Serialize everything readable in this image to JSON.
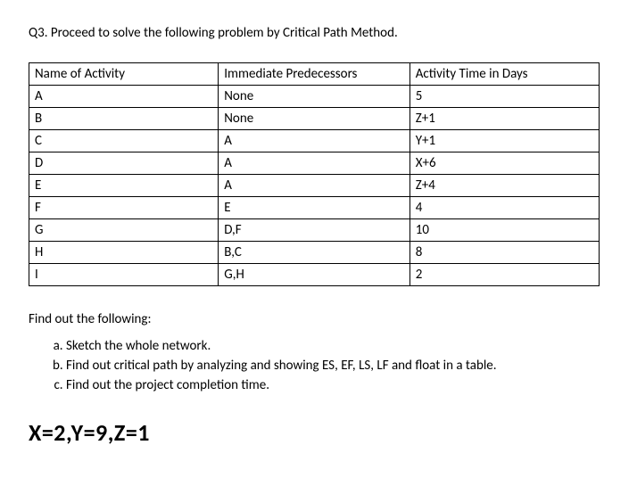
{
  "question_title": "Q3. Proceed to solve the following problem by Critical Path Method.",
  "table": {
    "headers": {
      "name": "Name of Activity",
      "pred": "Immediate Predecessors",
      "time": "Activity Time in Days"
    },
    "rows": [
      {
        "name": "A",
        "pred": "None",
        "time": "5"
      },
      {
        "name": "B",
        "pred": "None",
        "time": "Z+1"
      },
      {
        "name": "C",
        "pred": "A",
        "time": "Y+1"
      },
      {
        "name": "D",
        "pred": "A",
        "time": "X+6"
      },
      {
        "name": "E",
        "pred": "A",
        "time": "Z+4"
      },
      {
        "name": "F",
        "pred": "E",
        "time": "4"
      },
      {
        "name": "G",
        "pred": "D,F",
        "time": "10"
      },
      {
        "name": "H",
        "pred": "B,C",
        "time": "8"
      },
      {
        "name": "I",
        "pred": "G,H",
        "time": "2"
      }
    ]
  },
  "followup_label": "Find out the following:",
  "subquestions": [
    "Sketch the whole network.",
    "Find out critical path by analyzing and showing ES, EF, LS, LF and float in a table.",
    "Find out the project completion time."
  ],
  "parameters": "X=2,Y=9,Z=1",
  "chart_data": {
    "type": "table",
    "columns": [
      "Name of Activity",
      "Immediate Predecessors",
      "Activity Time in Days"
    ],
    "rows": [
      [
        "A",
        "None",
        "5"
      ],
      [
        "B",
        "None",
        "Z+1"
      ],
      [
        "C",
        "A",
        "Y+1"
      ],
      [
        "D",
        "A",
        "X+6"
      ],
      [
        "E",
        "A",
        "Z+4"
      ],
      [
        "F",
        "E",
        "4"
      ],
      [
        "G",
        "D,F",
        "10"
      ],
      [
        "H",
        "B,C",
        "8"
      ],
      [
        "I",
        "G,H",
        "2"
      ]
    ],
    "variables": {
      "X": 2,
      "Y": 9,
      "Z": 1
    }
  }
}
